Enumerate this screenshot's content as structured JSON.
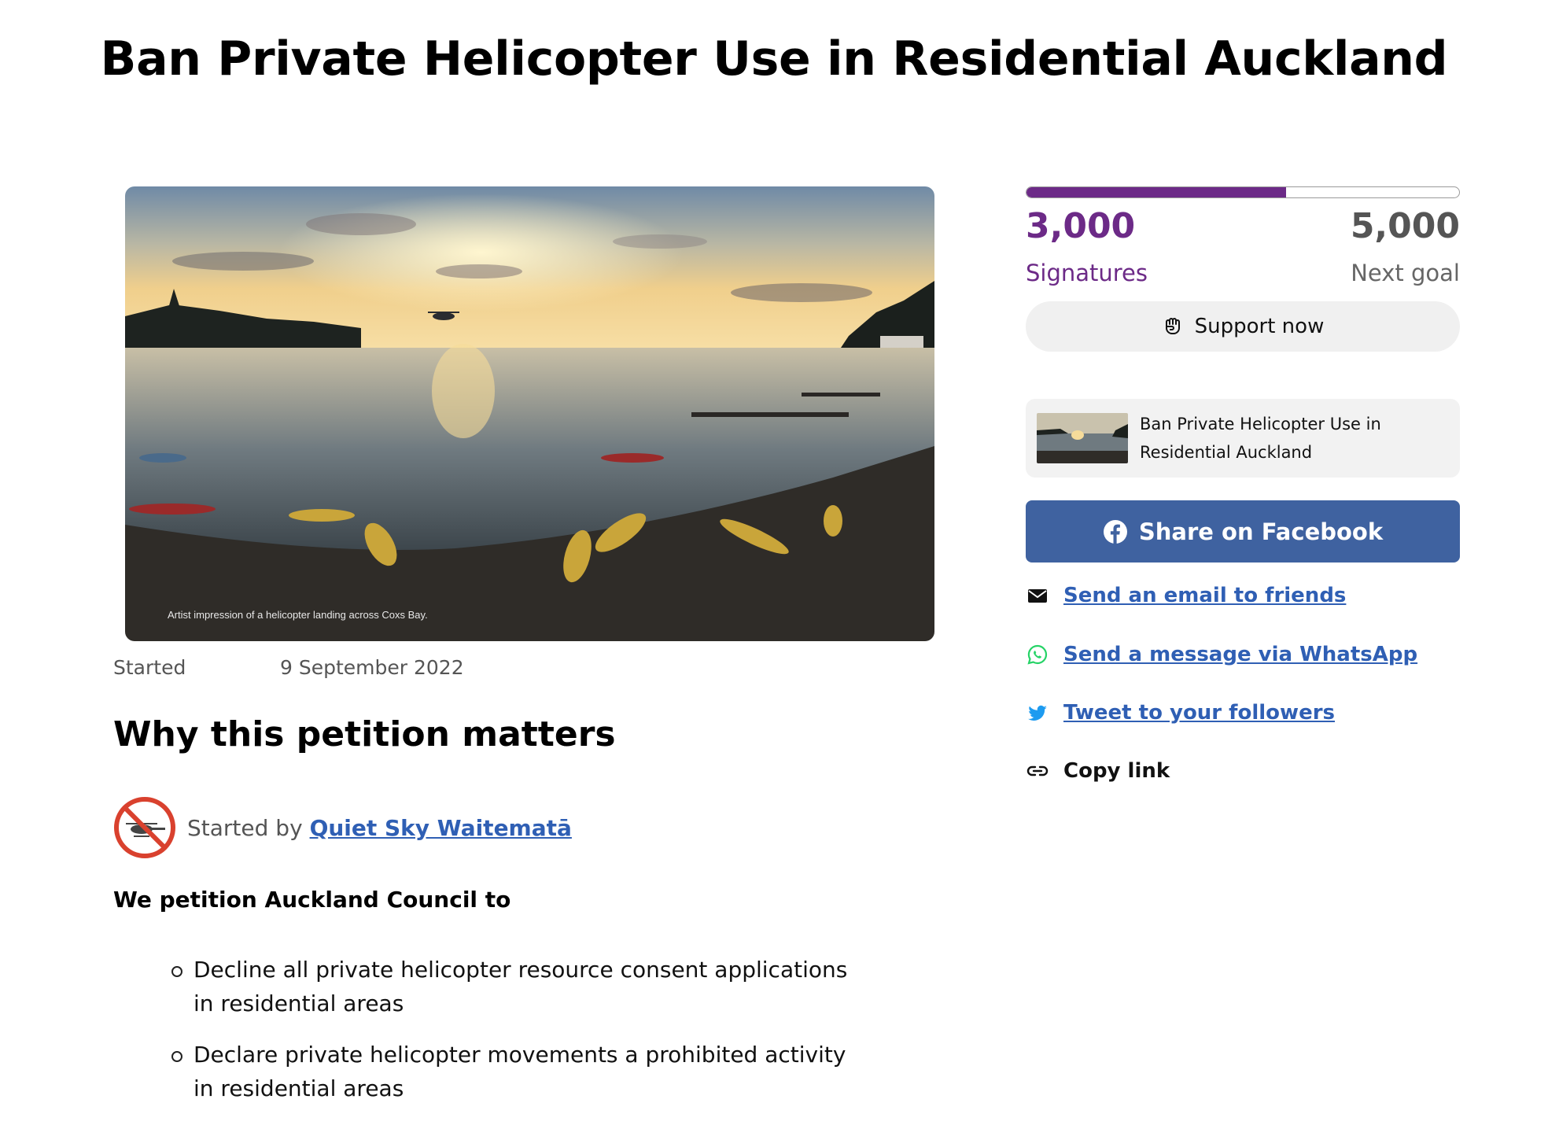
{
  "page": {
    "title": "Ban Private Helicopter Use in Residential Auckland"
  },
  "hero": {
    "caption": "Artist impression of a helicopter landing across Coxs Bay."
  },
  "meta": {
    "started_label": "Started",
    "started_date": "9 September 2022"
  },
  "body": {
    "section_title": "Why this petition matters",
    "started_by_prefix": "Started by",
    "starter_name": "Quiet Sky Waitematā",
    "intro": "We petition Auckland Council to",
    "demands": [
      "Decline all private helicopter resource consent applications in residential areas",
      "Declare private helicopter movements a prohibited activity in residential areas"
    ]
  },
  "sidebar": {
    "progress_fraction": 0.6,
    "signatures_count": "3,000",
    "signatures_label": "Signatures",
    "goal_count": "5,000",
    "goal_label": "Next goal",
    "support_label": "Support now",
    "share_card_title": "Ban Private Helicopter Use in Residential Auckland",
    "facebook_label": "Share on Facebook",
    "email_label": "Send an email to friends",
    "whatsapp_label": "Send a message via WhatsApp",
    "twitter_label": "Tweet to your followers",
    "copy_label": "Copy link"
  },
  "icons": {
    "support": "fist-icon",
    "facebook": "facebook-icon",
    "email": "envelope-icon",
    "whatsapp": "whatsapp-icon",
    "twitter": "twitter-bird-icon",
    "copy": "link-icon",
    "avatar": "no-helicopter-icon"
  },
  "colors": {
    "brand_purple": "#6c2a87",
    "facebook_blue": "#3f62a0",
    "link_blue": "#2f5fb4",
    "whatsapp_green": "#25d366",
    "twitter_blue": "#1d9bf0",
    "no_sign_red": "#d9412e"
  }
}
